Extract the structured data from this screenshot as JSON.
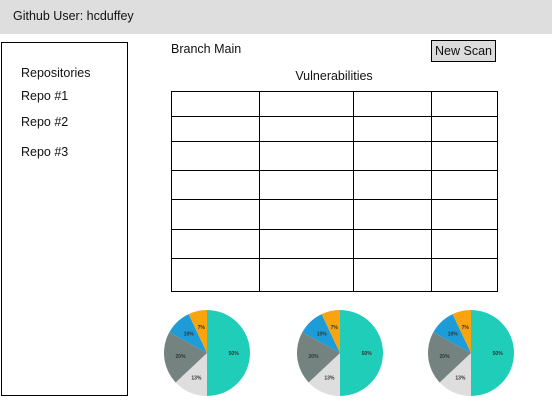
{
  "header": {
    "title": "Github User: hcduffey"
  },
  "sidebar": {
    "heading": "Repositories",
    "items": [
      {
        "label": "Repo #1"
      },
      {
        "label": "Repo #2"
      },
      {
        "label": "Repo #3"
      }
    ]
  },
  "main": {
    "branch_label": "Branch Main",
    "new_scan_label": "New Scan",
    "vulnerabilities_title": "Vulnerabilities",
    "table": {
      "rows": 7,
      "columns": 4
    }
  },
  "chart_data": [
    {
      "type": "pie",
      "slices": [
        {
          "label": "50%",
          "value": 50,
          "color": "#20cdb9"
        },
        {
          "label": "13%",
          "value": 13,
          "color": "#dedede"
        },
        {
          "label": "20%",
          "value": 20,
          "color": "#748380"
        },
        {
          "label": "10%",
          "value": 10,
          "color": "#1e9cd8"
        },
        {
          "label": "7%",
          "value": 7,
          "color": "#f8a40f"
        }
      ]
    },
    {
      "type": "pie",
      "slices": [
        {
          "label": "50%",
          "value": 50,
          "color": "#20cdb9"
        },
        {
          "label": "13%",
          "value": 13,
          "color": "#dedede"
        },
        {
          "label": "20%",
          "value": 20,
          "color": "#748380"
        },
        {
          "label": "10%",
          "value": 10,
          "color": "#1e9cd8"
        },
        {
          "label": "7%",
          "value": 7,
          "color": "#f8a40f"
        }
      ]
    },
    {
      "type": "pie",
      "slices": [
        {
          "label": "50%",
          "value": 50,
          "color": "#20cdb9"
        },
        {
          "label": "13%",
          "value": 13,
          "color": "#dedede"
        },
        {
          "label": "20%",
          "value": 20,
          "color": "#748380"
        },
        {
          "label": "10%",
          "value": 10,
          "color": "#1e9cd8"
        },
        {
          "label": "7%",
          "value": 7,
          "color": "#f8a40f"
        }
      ]
    }
  ]
}
